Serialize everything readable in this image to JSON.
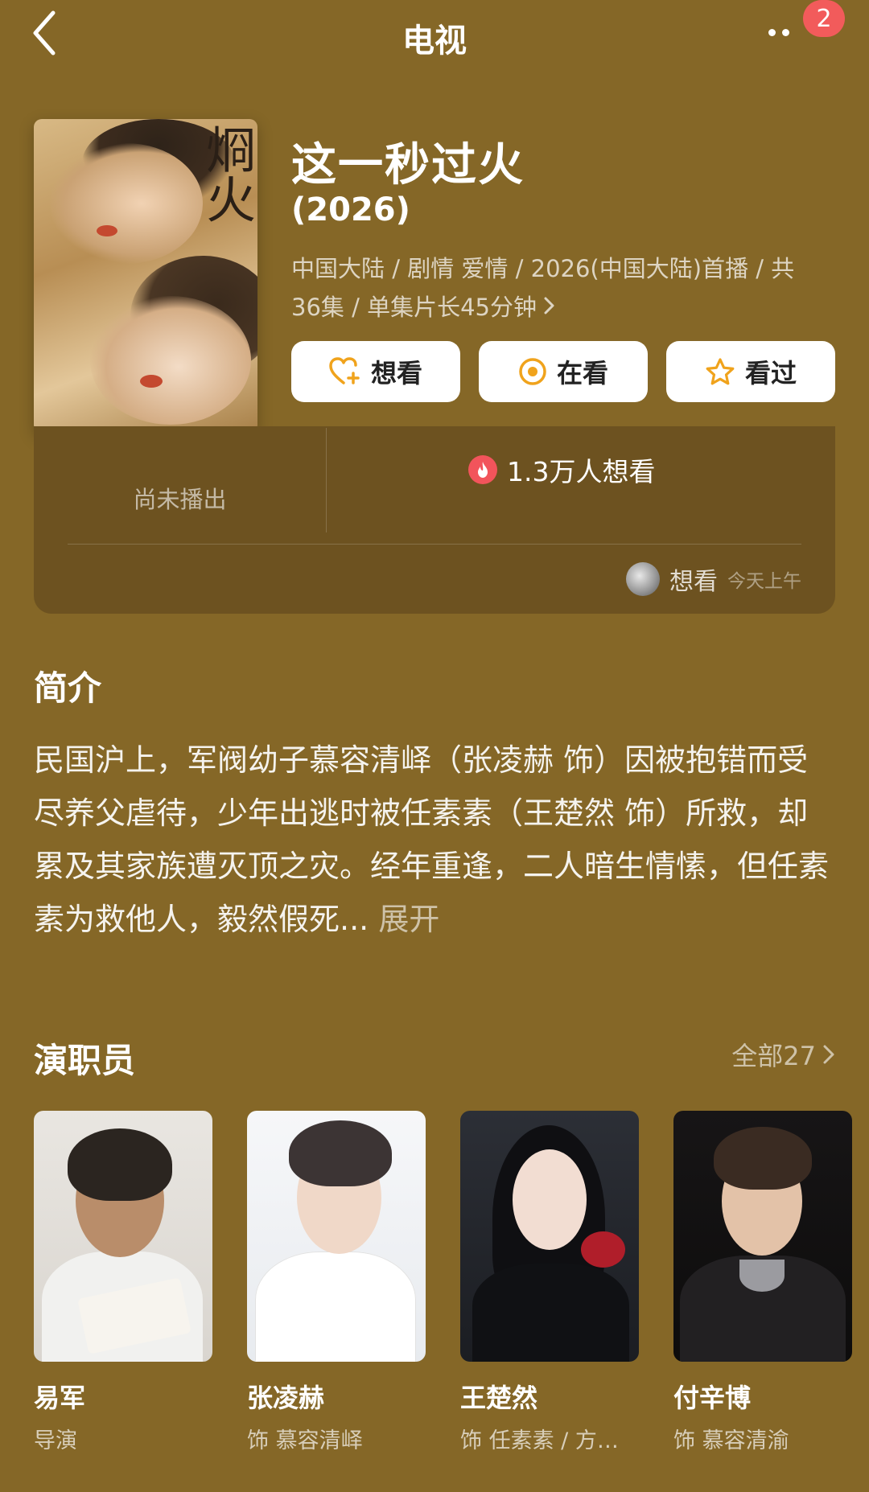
{
  "header": {
    "title": "电视",
    "notification_count": "2"
  },
  "show": {
    "title": "这一秒过火",
    "year": "(2026)",
    "meta": "中国大陆 / 剧情 爱情 / 2026(中国大陆)首播 / 共36集 / 单集片长45分钟",
    "poster_calligraphy": "烱火"
  },
  "actions": {
    "want_label": "想看",
    "watching_label": "在看",
    "watched_label": "看过"
  },
  "stats": {
    "not_aired": "尚未播出",
    "want_count": "1.3万人想看",
    "user_status": "想看",
    "user_time": "今天上午"
  },
  "intro": {
    "heading": "简介",
    "text": "民国沪上，军阀幼子慕容清峄（张凌赫 饰）因被抱错而受尽养父虐待，少年出逃时被任素素（王楚然 饰）所救，却累及其家族遭灭顶之灾。经年重逢，二人暗生情愫，但任素素为救他人，毅然假死...",
    "expand_label": "展开"
  },
  "cast": {
    "heading": "演职员",
    "see_all_label": "全部27",
    "members": [
      {
        "name": "易军",
        "role": "导演"
      },
      {
        "name": "张凌赫",
        "role": "饰 慕容清峄"
      },
      {
        "name": "王楚然",
        "role": "饰 任素素 / 方…"
      },
      {
        "name": "付辛博",
        "role": "饰 慕容清渝"
      }
    ]
  },
  "colors": {
    "background": "#856727",
    "card": "#6d5220",
    "accent_orange": "#f0a31c",
    "badge_red": "#f25b5b"
  }
}
